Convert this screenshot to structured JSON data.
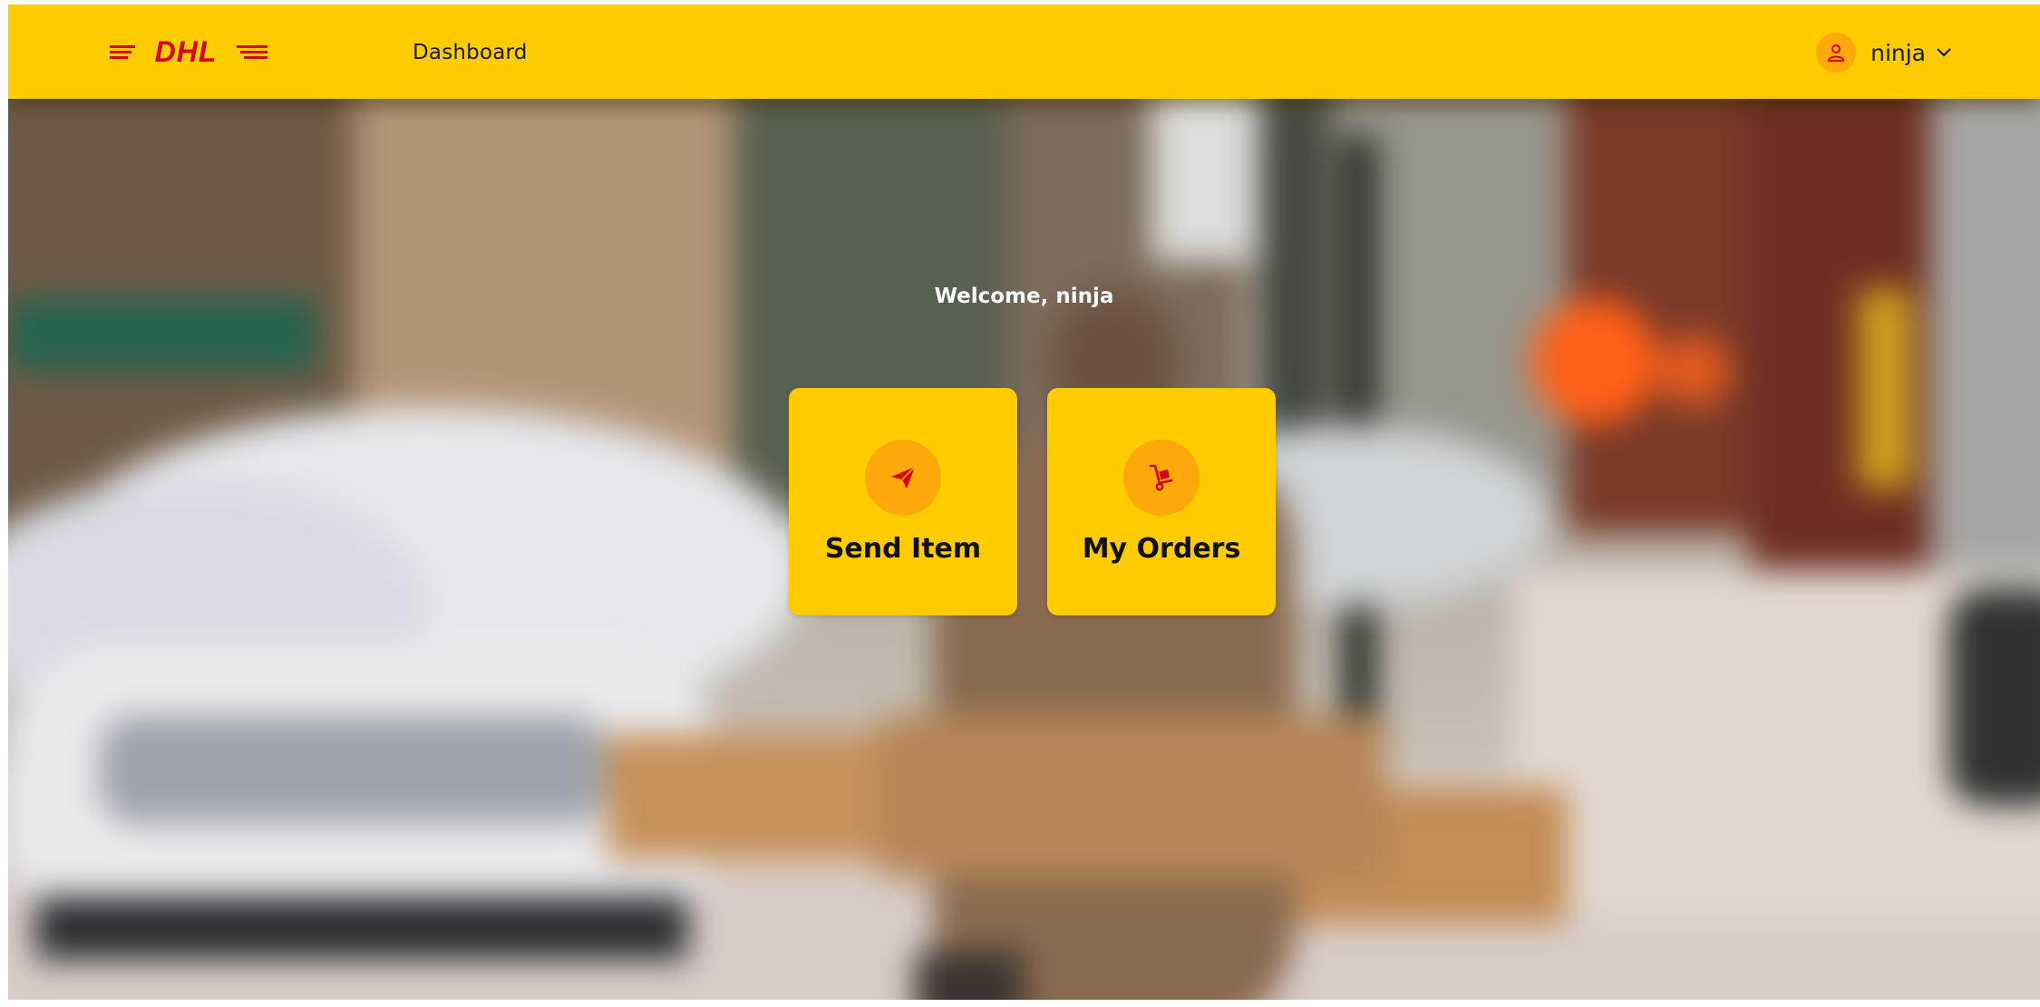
{
  "header": {
    "logo_text": "DHL",
    "nav_dashboard": "Dashboard",
    "user_name": "ninja"
  },
  "welcome": "Welcome, ninja",
  "cards": [
    {
      "label": "Send Item",
      "icon": "paper-plane-icon"
    },
    {
      "label": "My Orders",
      "icon": "hand-truck-icon"
    }
  ],
  "colors": {
    "brand_yellow": "#ffcc00",
    "brand_red": "#d40511",
    "icon_circle": "#ffa80a"
  }
}
